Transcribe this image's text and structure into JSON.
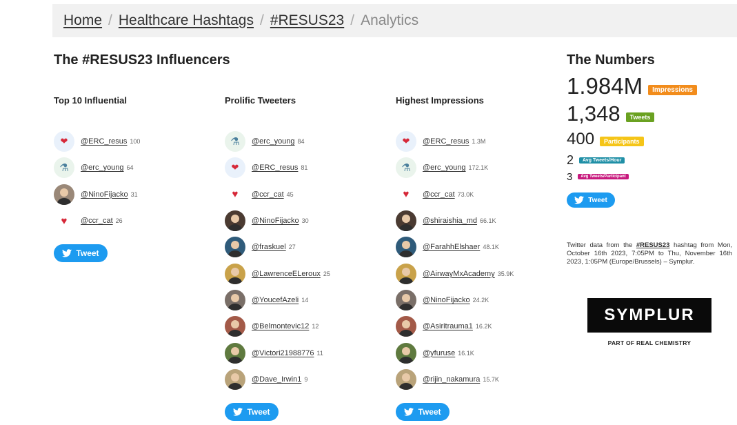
{
  "breadcrumb": {
    "items": [
      "Home",
      "Healthcare Hashtags",
      "#RESUS23"
    ],
    "current": "Analytics",
    "separator": "/"
  },
  "influencers": {
    "title": "The #RESUS23 Influencers",
    "columns": [
      {
        "heading": "Top 10 Influential",
        "rows": [
          {
            "handle": "@ERC_resus",
            "count": "100",
            "avatar": "lungs-heart-logo"
          },
          {
            "handle": "@erc_young",
            "count": "64",
            "avatar": "flask-logo"
          },
          {
            "handle": "@NinoFijacko",
            "count": "31",
            "avatar": "person-photo"
          },
          {
            "handle": "@ccr_cat",
            "count": "26",
            "avatar": "ccr-heart-logo"
          }
        ],
        "button": "Tweet"
      },
      {
        "heading": "Prolific Tweeters",
        "rows": [
          {
            "handle": "@erc_young",
            "count": "84",
            "avatar": "flask-logo"
          },
          {
            "handle": "@ERC_resus",
            "count": "81",
            "avatar": "lungs-heart-logo"
          },
          {
            "handle": "@ccr_cat",
            "count": "45",
            "avatar": "ccr-heart-logo"
          },
          {
            "handle": "@NinoFijacko",
            "count": "30",
            "avatar": "person-photo"
          },
          {
            "handle": "@fraskuel",
            "count": "27",
            "avatar": "person-photo"
          },
          {
            "handle": "@LawrenceELeroux",
            "count": "25",
            "avatar": "person-photo"
          },
          {
            "handle": "@YoucefAzeli",
            "count": "14",
            "avatar": "person-photo"
          },
          {
            "handle": "@Belmontevic12",
            "count": "12",
            "avatar": "person-photo"
          },
          {
            "handle": "@Victori21988776",
            "count": "11",
            "avatar": "person-photo"
          },
          {
            "handle": "@Dave_Irwin1",
            "count": "9",
            "avatar": "person-photo"
          }
        ],
        "button": "Tweet"
      },
      {
        "heading": "Highest Impressions",
        "rows": [
          {
            "handle": "@ERC_resus",
            "count": "1.3M",
            "avatar": "lungs-heart-logo"
          },
          {
            "handle": "@erc_young",
            "count": "172.1K",
            "avatar": "flask-logo"
          },
          {
            "handle": "@ccr_cat",
            "count": "73.0K",
            "avatar": "ccr-heart-logo"
          },
          {
            "handle": "@shiraishia_md",
            "count": "66.1K",
            "avatar": "person-photo"
          },
          {
            "handle": "@FarahhElshaer",
            "count": "48.1K",
            "avatar": "person-photo"
          },
          {
            "handle": "@AirwayMxAcademy",
            "count": "35.9K",
            "avatar": "person-photo"
          },
          {
            "handle": "@NinoFijacko",
            "count": "24.2K",
            "avatar": "person-photo"
          },
          {
            "handle": "@Asiritrauma1",
            "count": "16.2K",
            "avatar": "person-photo"
          },
          {
            "handle": "@yfuruse",
            "count": "16.1K",
            "avatar": "person-photo"
          },
          {
            "handle": "@rijin_nakamura",
            "count": "15.7K",
            "avatar": "person-photo"
          }
        ],
        "button": "Tweet"
      }
    ]
  },
  "numbers": {
    "title": "The Numbers",
    "stats": [
      {
        "value": "1.984M",
        "label": "Impressions",
        "color": "#f28c1b"
      },
      {
        "value": "1,348",
        "label": "Tweets",
        "color": "#6aa121"
      },
      {
        "value": "400",
        "label": "Participants",
        "color": "#f5c518"
      },
      {
        "value": "2",
        "label": "Avg Tweets/Hour",
        "color": "#1f8fa6"
      },
      {
        "value": "3",
        "label": "Avg Tweets/Participant",
        "color": "#c7197d"
      }
    ],
    "button": "Tweet",
    "info": {
      "before": "Twitter data from the ",
      "hashtag": "#RESUS23",
      "after": " hashtag from Mon, October 16th 2023, 7:05PM to Thu, November 16th 2023, 1:05PM (Europe/Brussels) – Symplur."
    },
    "logo": "SYMPLUR",
    "logo_sub": "PART OF REAL CHEMISTRY"
  },
  "colors": {
    "tweet_button": "#1d9bf0"
  }
}
